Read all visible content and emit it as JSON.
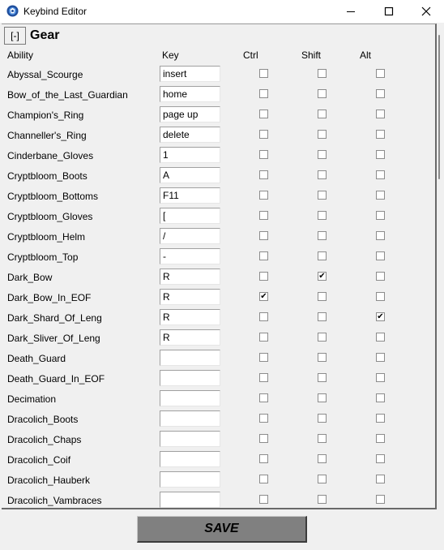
{
  "window": {
    "title": "Keybind Editor"
  },
  "section": {
    "collapse_label": "[-]",
    "title": "Gear"
  },
  "headers": {
    "ability": "Ability",
    "key": "Key",
    "ctrl": "Ctrl",
    "shift": "Shift",
    "alt": "Alt"
  },
  "rows": [
    {
      "ability": "Abyssal_Scourge",
      "key": "insert",
      "ctrl": false,
      "shift": false,
      "alt": false
    },
    {
      "ability": "Bow_of_the_Last_Guardian",
      "key": "home",
      "ctrl": false,
      "shift": false,
      "alt": false
    },
    {
      "ability": "Champion's_Ring",
      "key": "page up",
      "ctrl": false,
      "shift": false,
      "alt": false
    },
    {
      "ability": "Channeller's_Ring",
      "key": "delete",
      "ctrl": false,
      "shift": false,
      "alt": false
    },
    {
      "ability": "Cinderbane_Gloves",
      "key": "1",
      "ctrl": false,
      "shift": false,
      "alt": false
    },
    {
      "ability": "Cryptbloom_Boots",
      "key": "A",
      "ctrl": false,
      "shift": false,
      "alt": false
    },
    {
      "ability": "Cryptbloom_Bottoms",
      "key": "F11",
      "ctrl": false,
      "shift": false,
      "alt": false
    },
    {
      "ability": "Cryptbloom_Gloves",
      "key": "[",
      "ctrl": false,
      "shift": false,
      "alt": false
    },
    {
      "ability": "Cryptbloom_Helm",
      "key": "/",
      "ctrl": false,
      "shift": false,
      "alt": false
    },
    {
      "ability": "Cryptbloom_Top",
      "key": "-",
      "ctrl": false,
      "shift": false,
      "alt": false
    },
    {
      "ability": "Dark_Bow",
      "key": "R",
      "ctrl": false,
      "shift": true,
      "alt": false
    },
    {
      "ability": "Dark_Bow_In_EOF",
      "key": "R",
      "ctrl": true,
      "shift": false,
      "alt": false
    },
    {
      "ability": "Dark_Shard_Of_Leng",
      "key": "R",
      "ctrl": false,
      "shift": false,
      "alt": true
    },
    {
      "ability": "Dark_Sliver_Of_Leng",
      "key": "R",
      "ctrl": false,
      "shift": false,
      "alt": false,
      "focused": true
    },
    {
      "ability": "Death_Guard",
      "key": "",
      "ctrl": false,
      "shift": false,
      "alt": false
    },
    {
      "ability": "Death_Guard_In_EOF",
      "key": "",
      "ctrl": false,
      "shift": false,
      "alt": false
    },
    {
      "ability": "Decimation",
      "key": "",
      "ctrl": false,
      "shift": false,
      "alt": false
    },
    {
      "ability": "Dracolich_Boots",
      "key": "",
      "ctrl": false,
      "shift": false,
      "alt": false
    },
    {
      "ability": "Dracolich_Chaps",
      "key": "",
      "ctrl": false,
      "shift": false,
      "alt": false
    },
    {
      "ability": "Dracolich_Coif",
      "key": "",
      "ctrl": false,
      "shift": false,
      "alt": false
    },
    {
      "ability": "Dracolich_Hauberk",
      "key": "",
      "ctrl": false,
      "shift": false,
      "alt": false
    },
    {
      "ability": "Dracolich_Vambraces",
      "key": "",
      "ctrl": false,
      "shift": false,
      "alt": false
    }
  ],
  "save_label": "SAVE"
}
